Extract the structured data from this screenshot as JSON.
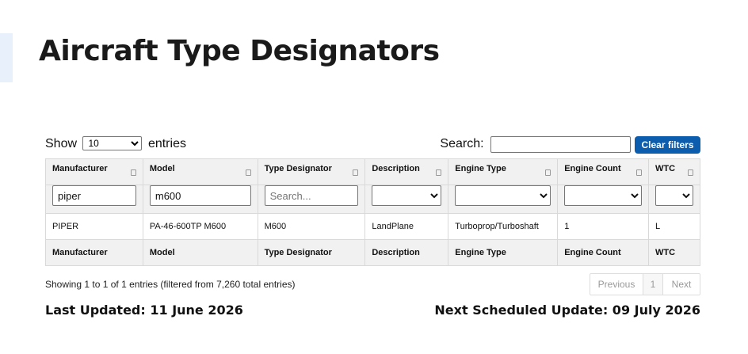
{
  "page": {
    "title": "Aircraft Type Designators"
  },
  "controls": {
    "show_label": "Show",
    "entries_label": "entries",
    "page_length": "10",
    "page_length_options": [
      "10"
    ],
    "search_label": "Search:",
    "search_value": "",
    "clear_filters_label": "Clear filters",
    "clear_filters_color": "#0d5dae"
  },
  "table": {
    "columns": [
      "Manufacturer",
      "Model",
      "Type Designator",
      "Description",
      "Engine Type",
      "Engine Count",
      "WTC"
    ],
    "filters": {
      "manufacturer": "piper",
      "model": "m600",
      "type_designator_placeholder": "Search..."
    },
    "rows": [
      [
        "PIPER",
        "PA-46-600TP M600",
        "M600",
        "LandPlane",
        "Turboprop/Turboshaft",
        "1",
        "L"
      ]
    ],
    "footer": [
      "Manufacturer",
      "Model",
      "Type Designator",
      "Description",
      "Engine Type",
      "Engine Count",
      "WTC"
    ]
  },
  "info": "Showing 1 to 1 of 1 entries (filtered from 7,260 total entries)",
  "pagination": {
    "previous": "Previous",
    "current": "1",
    "next": "Next"
  },
  "status": {
    "last_updated": "Last Updated: 11 June 2026",
    "next_update": "Next Scheduled Update: 09 July 2026"
  }
}
